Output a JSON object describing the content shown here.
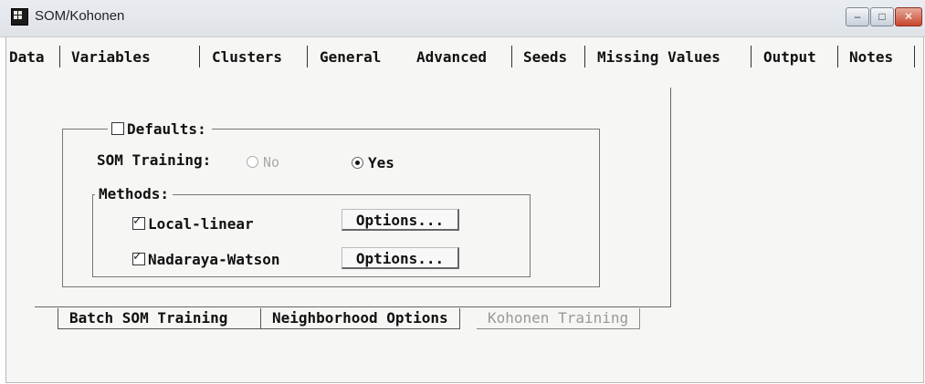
{
  "window": {
    "title": "SOM/Kohonen",
    "controls": {
      "minimize": "–",
      "maximize": "□",
      "close": "✕"
    }
  },
  "tabs": [
    {
      "label": "Data"
    },
    {
      "label": "Variables"
    },
    {
      "label": "Clusters"
    },
    {
      "label": "General"
    },
    {
      "label": "Advanced"
    },
    {
      "label": "Seeds"
    },
    {
      "label": "Missing Values"
    },
    {
      "label": "Output"
    },
    {
      "label": "Notes"
    }
  ],
  "active_tab": "Advanced",
  "defaults": {
    "label": "Defaults:",
    "checked": false
  },
  "som_training": {
    "label": "SOM Training:",
    "options": [
      {
        "label": "No",
        "selected": false,
        "enabled": false
      },
      {
        "label": "Yes",
        "selected": true,
        "enabled": true
      }
    ]
  },
  "methods": {
    "legend": "Methods:",
    "items": [
      {
        "label": "Local-linear",
        "checked": true,
        "button": "Options..."
      },
      {
        "label": "Nadaraya-Watson",
        "checked": true,
        "button": "Options..."
      }
    ]
  },
  "subtabs": [
    {
      "label": "Batch SOM Training",
      "state": "active"
    },
    {
      "label": "Neighborhood Options",
      "state": "normal"
    },
    {
      "label": "Kohonen Training",
      "state": "disabled"
    }
  ]
}
